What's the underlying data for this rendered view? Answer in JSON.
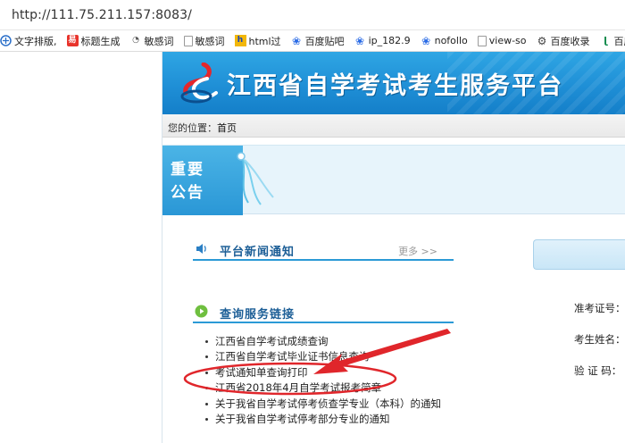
{
  "browser": {
    "url": "http://111.75.211.157:8083/",
    "bookmarks": [
      {
        "icon": "text-layout-icon",
        "label": "文字排版,"
      },
      {
        "icon": "yi-logo-icon",
        "label": "标题生成"
      },
      {
        "icon": "page-icon",
        "label": "敏感词"
      },
      {
        "icon": "page-icon",
        "label": "敏感词"
      },
      {
        "icon": "html-icon",
        "label": "html过"
      },
      {
        "icon": "baidu-paw-icon",
        "label": "百度贴吧"
      },
      {
        "icon": "baidu-paw-icon",
        "label": "ip_182.9"
      },
      {
        "icon": "baidu-paw-icon",
        "label": "nofollo"
      },
      {
        "icon": "page-icon",
        "label": "view-so"
      },
      {
        "icon": "gear-icon",
        "label": "百度收录"
      },
      {
        "icon": "x-icon",
        "label": "百度"
      }
    ]
  },
  "site": {
    "title": "江西省自学考试考生服务平台",
    "breadcrumb_prefix": "您的位置：",
    "breadcrumb_home": "首页",
    "notice_line1": "重要",
    "notice_line2": "公告"
  },
  "news": {
    "title": "平台新闻通知",
    "more": "更多 >>"
  },
  "query": {
    "title": "查询服务链接",
    "links": [
      "江西省自学考试成绩查询",
      "江西省自学考试毕业证书信息查询",
      "考试通知单查询打印",
      "江西省2018年4月自学考试报考简章",
      "关于我省自学考试停考侦查学专业（本科）的通知",
      "关于我省自学考试停考部分专业的通知"
    ]
  },
  "login": {
    "exam_no_label": "准考证号：",
    "name_label": "考生姓名：",
    "captcha_label": "验 证 码："
  },
  "colors": {
    "banner": "#1f8fd6",
    "section_title": "#1d5f97",
    "annotation": "#e0262b"
  }
}
